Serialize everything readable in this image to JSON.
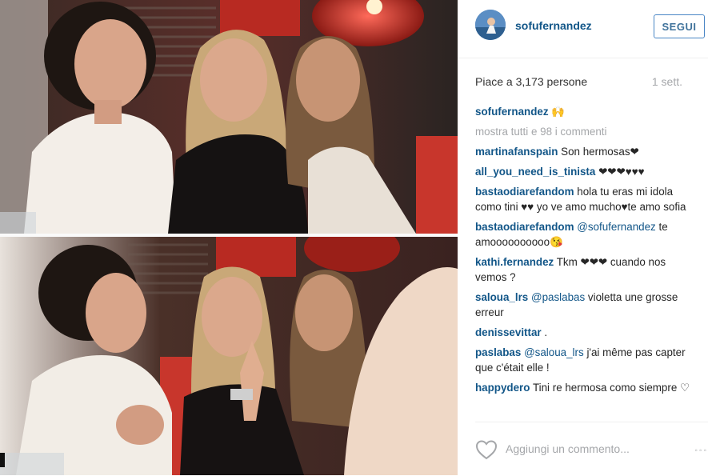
{
  "post": {
    "username": "sofufernandez",
    "follow_label": "SEGUI",
    "likes_text": "Piace a 3,173 persone",
    "time_text": "1 sett.",
    "caption": {
      "user": "sofufernandez",
      "text": "🙌"
    },
    "show_all_text": "mostra tutti e 98 i commenti",
    "comments": [
      {
        "user": "martinafanspain",
        "text": "Son hermosas❤"
      },
      {
        "user": "all_you_need_is_tinista",
        "text": "❤❤❤♥♥♥"
      },
      {
        "user": "bastaodiarefandom",
        "text": "hola tu eras mi idola como tini ♥♥ yo ve amo mucho♥te amo sofia"
      },
      {
        "user": "bastaodiarefandom",
        "mention": "@sofufernandez",
        "text": "te amoooooooooo😘"
      },
      {
        "user": "kathi.fernandez",
        "text": "Tkm ❤❤❤ cuando nos vemos ?"
      },
      {
        "user": "saloua_lrs",
        "mention": "@paslabas",
        "text": "violetta une grosse erreur"
      },
      {
        "user": "denissevittar",
        "text": "."
      },
      {
        "user": "paslabas",
        "mention": "@saloua_lrs",
        "text": "j'ai même pas capter que c'était elle !"
      },
      {
        "user": "happydero",
        "text": "Tini re hermosa como siempre ♡"
      }
    ],
    "add_comment_placeholder": "Aggiungi un commento...",
    "more_icon": "◦◦◦"
  },
  "icons": {
    "heart": "heart-outline-icon",
    "more": "more-options-icon"
  },
  "colors": {
    "username": "#125688",
    "muted": "#a5a7aa",
    "follow_border": "#4a86c5"
  }
}
